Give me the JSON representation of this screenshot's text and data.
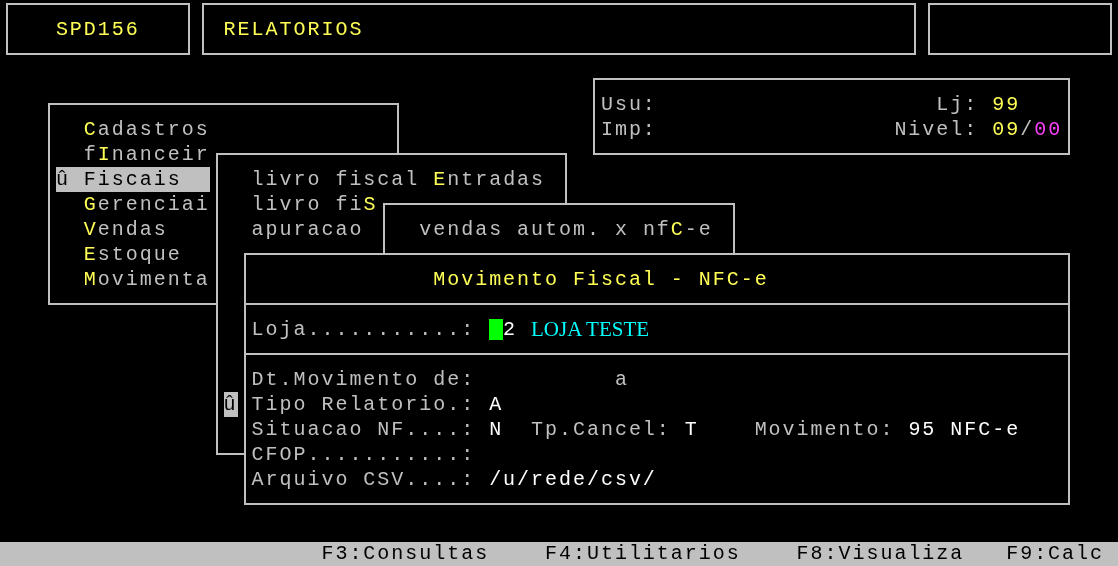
{
  "header": {
    "program": "SPD156",
    "title": "RELATORIOS"
  },
  "info": {
    "user_label": "Usu:",
    "printer_label": "Imp:",
    "store_label": "Lj:",
    "store": "99",
    "level_label": "Nivel:",
    "level_user": "09",
    "separator": "/",
    "level_required": "00"
  },
  "main_menu": {
    "items": [
      {
        "key": "C",
        "after": "adastros",
        "selected": false
      },
      {
        "before": "f",
        "key": "I",
        "after": "nanceir",
        "selected": false
      },
      {
        "marker": "û",
        "key": "F",
        "after": "iscais",
        "selected": true
      },
      {
        "key": "G",
        "after": "erenciai",
        "selected": false
      },
      {
        "key": "V",
        "after": "endas",
        "selected": false
      },
      {
        "key": "E",
        "after": "stoque",
        "selected": false
      },
      {
        "key": "M",
        "after": "ovimenta",
        "selected": false
      }
    ]
  },
  "submenu": {
    "marker": "û",
    "items": [
      {
        "before": "livro fiscal ",
        "key": "E",
        "after": "ntradas",
        "selected": false
      },
      {
        "before": "livro fi",
        "key": "S",
        "selected": false
      },
      {
        "before": "apuracao",
        "selected": false
      }
    ]
  },
  "report_menu": {
    "items": [
      {
        "before": "vendas autom. x nf",
        "key": "C",
        "after": "-e",
        "selected": false
      }
    ]
  },
  "form": {
    "title": "Movimento Fiscal - NFC-e",
    "store": {
      "label": "Loja...........:",
      "value": "2",
      "name": "LOJA TESTE"
    },
    "rows": [
      [
        {
          "kind": "label",
          "text": "Dt.Movimento de:"
        },
        {
          "kind": "label",
          "text": "a"
        }
      ],
      [
        {
          "kind": "label",
          "text": "Tipo Relatorio.:"
        },
        {
          "kind": "value",
          "text": "A"
        }
      ],
      [
        {
          "kind": "label",
          "text": "Situacao NF....:"
        },
        {
          "kind": "value",
          "text": "N"
        },
        {
          "kind": "label",
          "text": "Tp.Cancel:"
        },
        {
          "kind": "value",
          "text": "T"
        },
        {
          "kind": "label",
          "text": "Movimento:"
        },
        {
          "kind": "value",
          "text": "95 NFC-e"
        }
      ],
      [
        {
          "kind": "label",
          "text": "CFOP...........:"
        }
      ],
      [
        {
          "kind": "label",
          "text": "Arquivo CSV....:"
        },
        {
          "kind": "value",
          "text": "/u/rede/csv/"
        }
      ]
    ]
  },
  "function_keys": [
    "F3:Consultas",
    "F4:Utilitarios",
    "F8:Visualiza",
    "F9:Calc"
  ]
}
